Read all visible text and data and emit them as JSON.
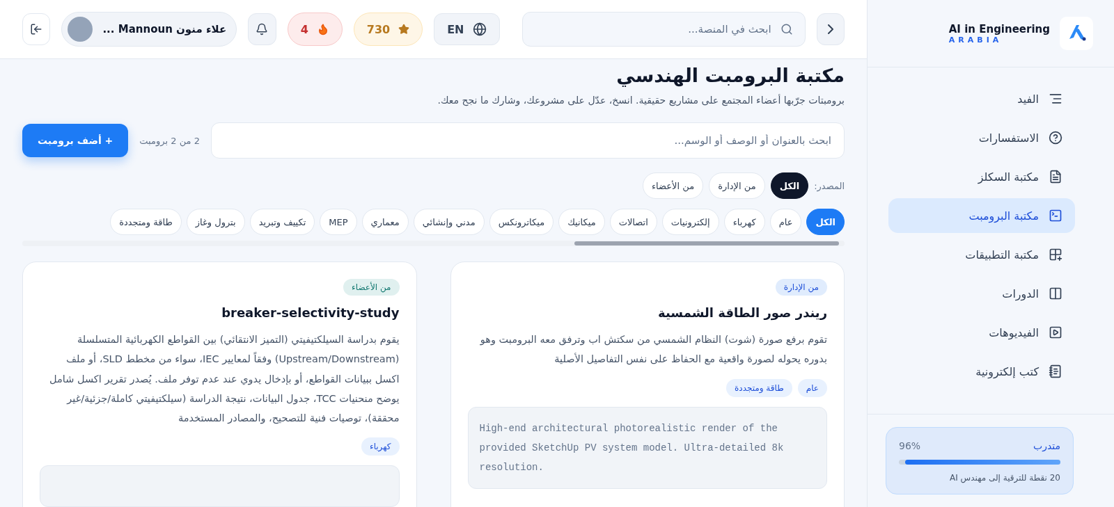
{
  "sidebar": {
    "brand": {
      "title": "AI in Engineering",
      "subtitle": "ARABIA"
    },
    "items": [
      {
        "label": "الفيد",
        "selected": false
      },
      {
        "label": "الاستفسارات",
        "selected": false
      },
      {
        "label": "مكتبة السكلز",
        "selected": false
      },
      {
        "label": "مكتبة البرومبت",
        "selected": true
      },
      {
        "label": "مكتبة التطبيقات",
        "selected": false
      },
      {
        "label": "الدورات",
        "selected": false
      },
      {
        "label": "الفيديوهات",
        "selected": false
      },
      {
        "label": "كتب إلكترونية",
        "selected": false
      }
    ],
    "progress": {
      "rank": "متدرب",
      "percent": "96%",
      "level": 0.96,
      "note": "20 نقطة للترقية إلى مهندس AI"
    }
  },
  "header": {
    "search": {
      "placeholder": "ابحث في المنصة..."
    },
    "language": "EN",
    "points": "730",
    "streak": "4",
    "user": {
      "name": "علاء منون Mannoun ..."
    }
  },
  "page": {
    "title": "مكتبة البرومبت الهندسي",
    "subtitle": "برومبتات جرّبها أعضاء المجتمع على مشاريع حقيقية. انسخ، عدّل على مشروعك، وشارك ما نجح معك.",
    "search": {
      "placeholder": "ابحث بالعنوان أو الوصف أو الوسم..."
    },
    "count": "2 من 2 برومبت",
    "add_button": "+ أضف برومبت",
    "source_label": "المصدر:",
    "source_filters": [
      {
        "label": "الكل",
        "selected": true
      },
      {
        "label": "من الإدارة",
        "selected": false
      },
      {
        "label": "من الأعضاء",
        "selected": false
      }
    ],
    "categories": [
      {
        "label": "الكل",
        "selected": true
      },
      {
        "label": "عام",
        "selected": false
      },
      {
        "label": "كهرباء",
        "selected": false
      },
      {
        "label": "إلكترونيات",
        "selected": false
      },
      {
        "label": "اتصالات",
        "selected": false
      },
      {
        "label": "ميكانيك",
        "selected": false
      },
      {
        "label": "ميكاترونكس",
        "selected": false
      },
      {
        "label": "مدني وإنشائي",
        "selected": false
      },
      {
        "label": "معماري",
        "selected": false
      },
      {
        "label": "MEP",
        "selected": false
      },
      {
        "label": "تكييف وتبريد",
        "selected": false
      },
      {
        "label": "بترول وغاز",
        "selected": false
      },
      {
        "label": "طاقة ومتجددة",
        "selected": false
      }
    ],
    "cards": [
      {
        "source": {
          "kind": "admin",
          "label": "من الإدارة"
        },
        "title": "ريندر صور الطاقة الشمسية",
        "description": "تقوم برفع صورة (شوت) النظام الشمسي من سكتش اب وترفق معه البرومبت وهو بدوره يحوله لصورة واقعية مع الحفاظ على نفس التفاصيل الأصلية",
        "tags": [
          "عام",
          "طاقة ومتجددة"
        ],
        "prompt": "High-end architectural photorealistic render of the provided SketchUp PV system model. Ultra-detailed 8k resolution."
      },
      {
        "source": {
          "kind": "members",
          "label": "من الأعضاء"
        },
        "title": "breaker-selectivity-study",
        "description": "يقوم بدراسة السيلكتيفيتي (التميز الانتقائي) بين القواطع الكهربائية المتسلسلة (Upstream/Downstream) وفقاً لمعايير IEC، سواء من مخطط SLD، أو ملف اكسل ببيانات القواطع، أو بإدخال يدوي عند عدم توفر ملف. يُصدر تقرير اكسل شامل يوضح منحنيات TCC، جدول البيانات، نتيجة الدراسة (سيلكتيفيتي كاملة/جزئية/غير محققة)، توصيات فنية للتصحيح، والمصادر المستخدمة",
        "tags": [
          "كهرباء"
        ]
      }
    ]
  }
}
